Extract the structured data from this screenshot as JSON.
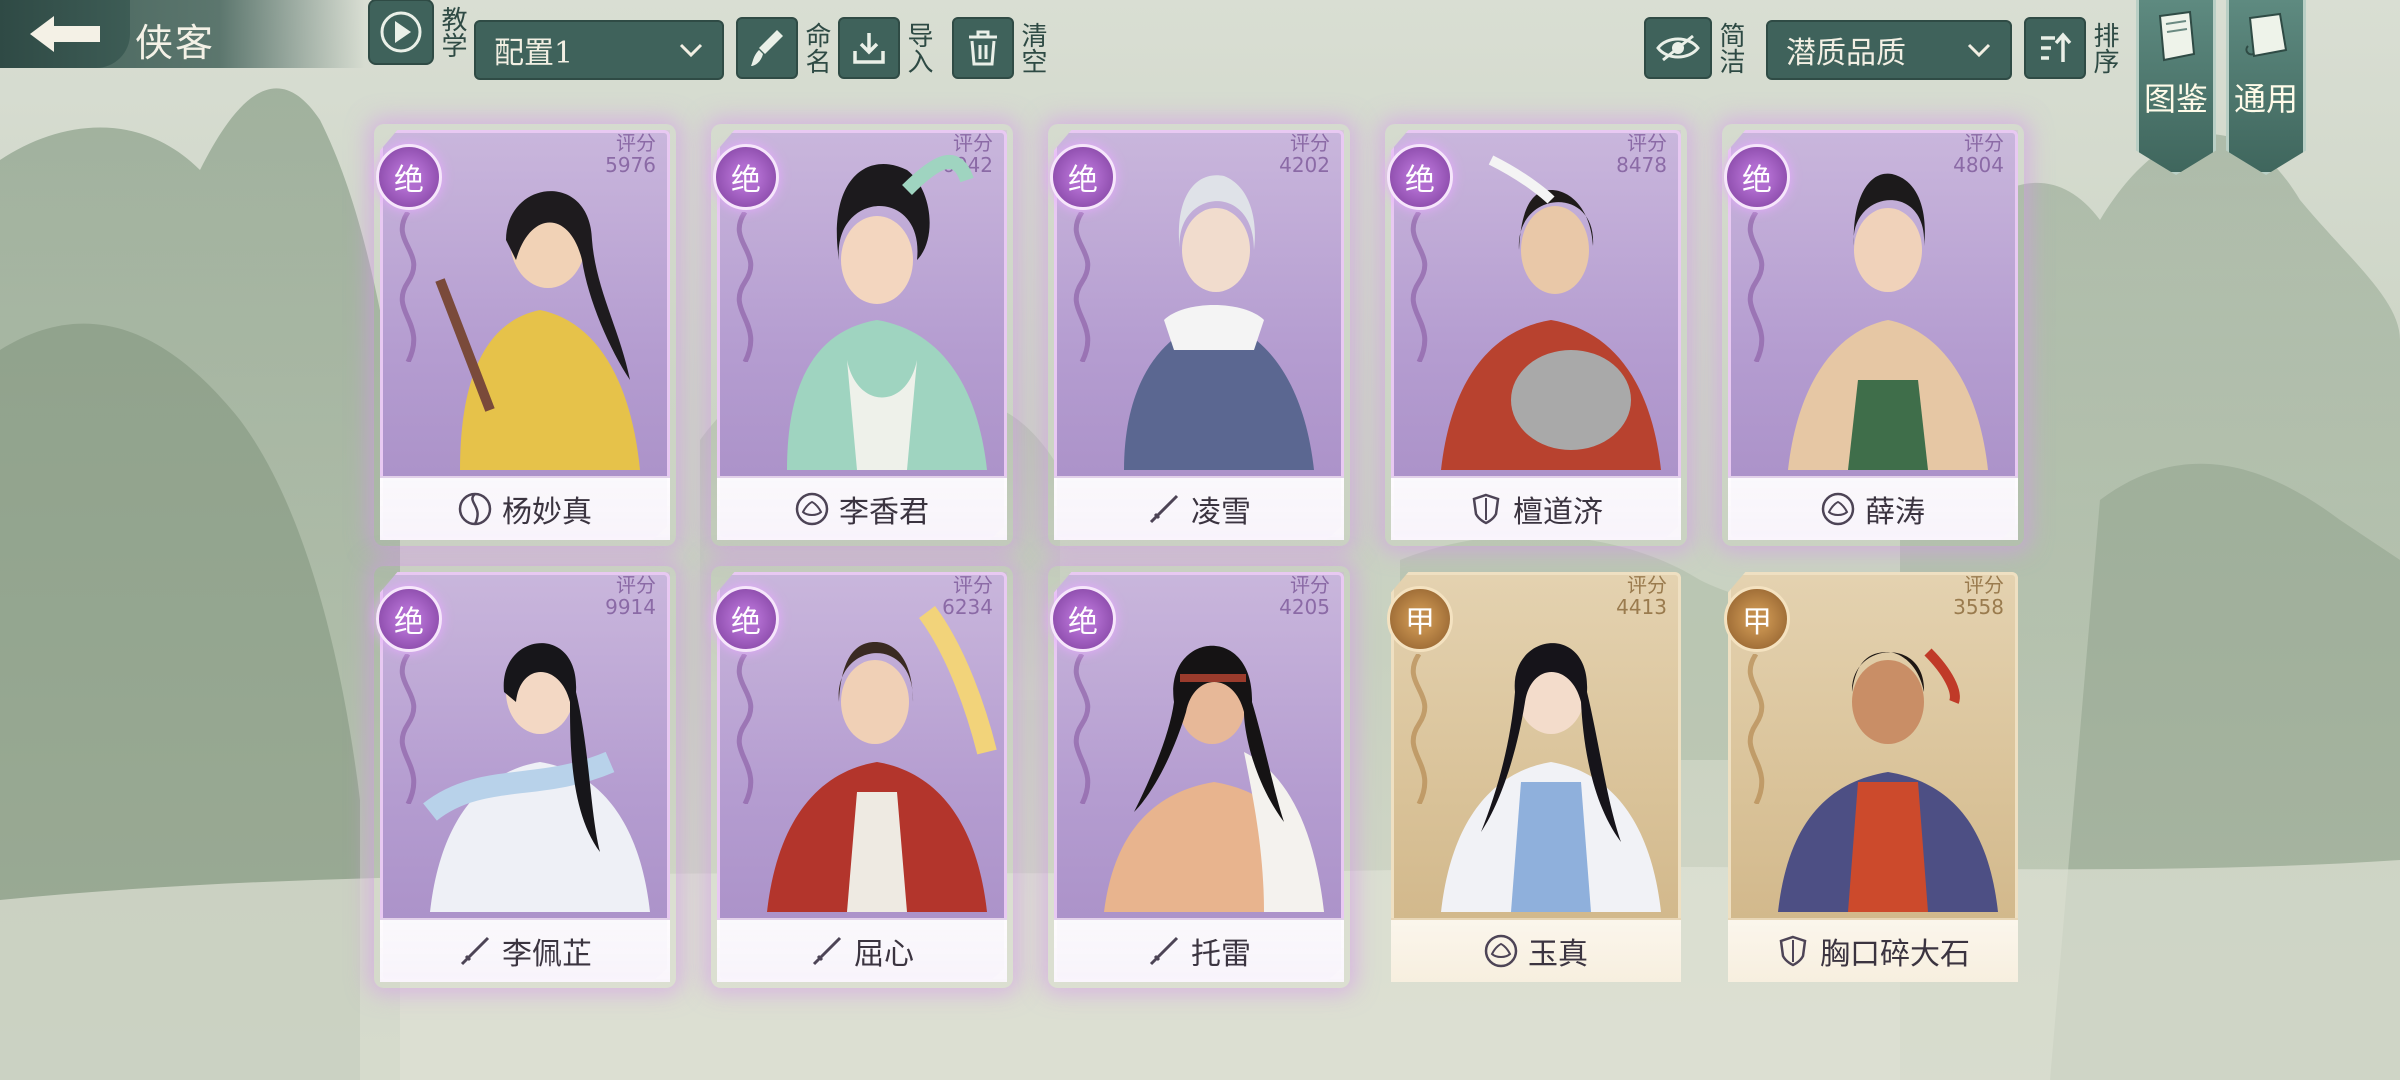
{
  "page": {
    "title": "侠客"
  },
  "toolbar": {
    "tutorial_label": "教学",
    "config_select_value": "配置1",
    "rename_label": "命名",
    "import_label": "导入",
    "clear_label": "清空",
    "simple_label": "简洁",
    "sort_select_value": "潜质品质",
    "sort_label": "排序",
    "tab_codex": "图鉴",
    "tab_general": "通用"
  },
  "cards": [
    {
      "name": "杨妙真",
      "score_label": "评分",
      "score": "5976",
      "grade": "绝",
      "rarity": "purple",
      "school_icon": "yin-yang-icon"
    },
    {
      "name": "李香君",
      "score_label": "评分",
      "score": "6042",
      "grade": "绝",
      "rarity": "purple",
      "school_icon": "lotus-icon"
    },
    {
      "name": "凌雪",
      "score_label": "评分",
      "score": "4202",
      "grade": "绝",
      "rarity": "purple",
      "school_icon": "sword-icon"
    },
    {
      "name": "檀道济",
      "score_label": "评分",
      "score": "8478",
      "grade": "绝",
      "rarity": "purple",
      "school_icon": "shield-icon"
    },
    {
      "name": "薛涛",
      "score_label": "评分",
      "score": "4804",
      "grade": "绝",
      "rarity": "purple",
      "school_icon": "lotus-icon"
    },
    {
      "name": "李佩芷",
      "score_label": "评分",
      "score": "9914",
      "grade": "绝",
      "rarity": "purple",
      "school_icon": "sword-icon"
    },
    {
      "name": "屈心",
      "score_label": "评分",
      "score": "6234",
      "grade": "绝",
      "rarity": "purple",
      "school_icon": "sword-icon"
    },
    {
      "name": "托雷",
      "score_label": "评分",
      "score": "4205",
      "grade": "绝",
      "rarity": "purple",
      "school_icon": "sword-icon"
    },
    {
      "name": "玉真",
      "score_label": "评分",
      "score": "4413",
      "grade": "甲",
      "rarity": "gold",
      "school_icon": "lotus-icon"
    },
    {
      "name": "胸口碎大石",
      "score_label": "评分",
      "score": "3558",
      "grade": "甲",
      "rarity": "gold",
      "school_icon": "shield-icon"
    }
  ],
  "colors": {
    "toolbar_bg": "#3f625b",
    "purple_card": "#b49cd0",
    "gold_card": "#d9c298",
    "title_text": "#f4f1e6"
  }
}
